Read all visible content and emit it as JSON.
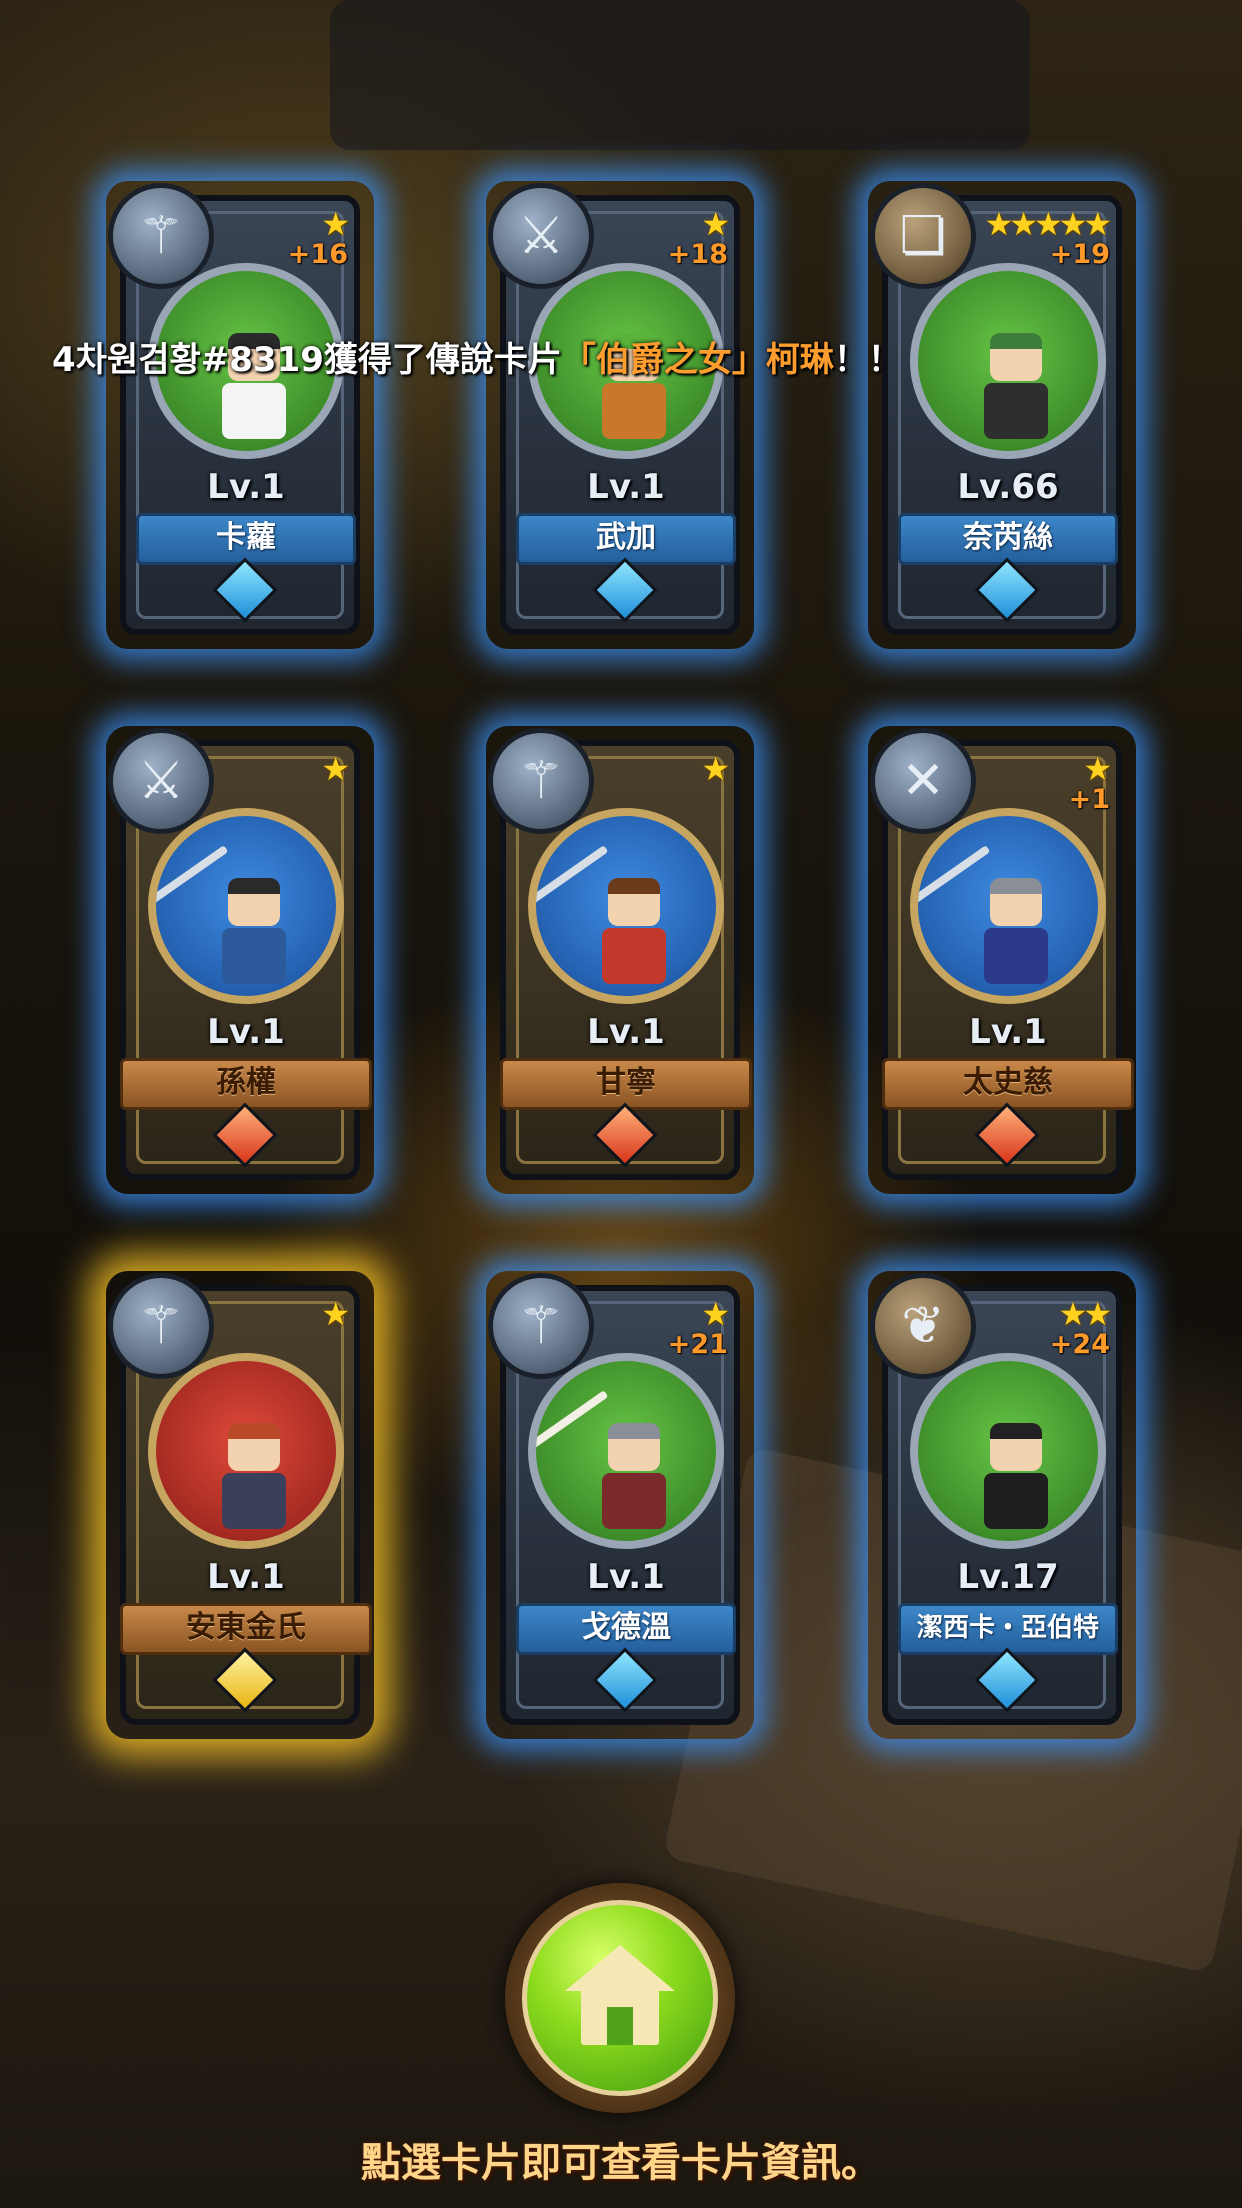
{
  "announcement": {
    "player": "4차원검황#8319",
    "action": "獲得了傳說卡片",
    "card_title": "「伯爵之女」",
    "card_name": "柯琳",
    "suffix": "！！"
  },
  "cards": [
    {
      "name": "卡蘿",
      "level": "Lv.1",
      "stars": "★",
      "plus": "+16",
      "class_icon": "trident-icon",
      "portrait": "green",
      "ribbon": "blue",
      "gem": "blue"
    },
    {
      "name": "武加",
      "level": "Lv.1",
      "stars": "★",
      "plus": "+18",
      "class_icon": "axe-icon",
      "portrait": "green",
      "ribbon": "blue",
      "gem": "blue"
    },
    {
      "name": "奈芮絲",
      "level": "Lv.66",
      "stars": "★★★★★",
      "plus": "+19",
      "class_icon": "book-icon",
      "portrait": "green",
      "ribbon": "blue",
      "gem": "blue"
    },
    {
      "name": "孫權",
      "level": "Lv.1",
      "stars": "★",
      "plus": "",
      "class_icon": "axe-icon",
      "portrait": "blue",
      "ribbon": "bronze",
      "gem": "red"
    },
    {
      "name": "甘寧",
      "level": "Lv.1",
      "stars": "★",
      "plus": "",
      "class_icon": "trident-icon",
      "portrait": "blue",
      "ribbon": "bronze",
      "gem": "red"
    },
    {
      "name": "太史慈",
      "level": "Lv.1",
      "stars": "★",
      "plus": "+1",
      "class_icon": "crossed-swords-icon",
      "portrait": "blue",
      "ribbon": "bronze",
      "gem": "red"
    },
    {
      "name": "安東金氏",
      "level": "Lv.1",
      "stars": "★",
      "plus": "",
      "class_icon": "trident-icon",
      "portrait": "red",
      "ribbon": "bronze",
      "gem": "yellow"
    },
    {
      "name": "戈德溫",
      "level": "Lv.1",
      "stars": "★",
      "plus": "+21",
      "class_icon": "trident-icon",
      "portrait": "green",
      "ribbon": "blue",
      "gem": "blue"
    },
    {
      "name": "潔西卡・亞伯特",
      "level": "Lv.17",
      "stars": "★★",
      "plus": "+24",
      "class_icon": "wings-icon",
      "portrait": "green",
      "ribbon": "blue",
      "gem": "blue"
    }
  ],
  "home_button": {
    "icon": "home-icon"
  },
  "hint": "點選卡片即可查看卡片資訊。",
  "colors": {
    "highlight": "#ff9d2e",
    "hint": "#ffd58a",
    "home_green": "#8fdc1e"
  }
}
